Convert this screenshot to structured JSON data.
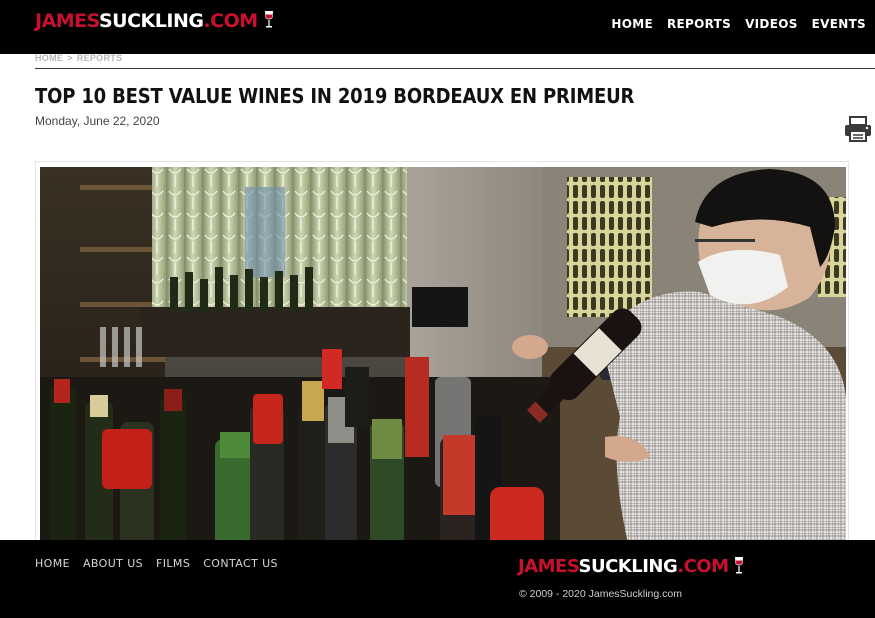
{
  "brand": {
    "logo_red": "JAMES",
    "logo_white": "SUCKLING",
    "logo_suffix": ".COM"
  },
  "header": {
    "nav": [
      "HOME",
      "REPORTS",
      "VIDEOS",
      "EVENTS"
    ]
  },
  "breadcrumb": {
    "items": [
      "HOME",
      "REPORTS"
    ],
    "separator": ">"
  },
  "article": {
    "title": "TOP 10 BEST VALUE WINES IN 2019 BORDEAUX EN PRIMEUR",
    "date": "Monday, June 22, 2020"
  },
  "footer": {
    "nav": [
      "HOME",
      "ABOUT US",
      "FILMS",
      "CONTACT US"
    ],
    "copyright": "© 2009 - 2020 JamesSuckling.com"
  },
  "icons": {
    "print": "printer-icon",
    "logo_glass": "wine-glass-icon"
  },
  "colors": {
    "brand_red": "#c8102e",
    "header_bg": "#000000"
  }
}
